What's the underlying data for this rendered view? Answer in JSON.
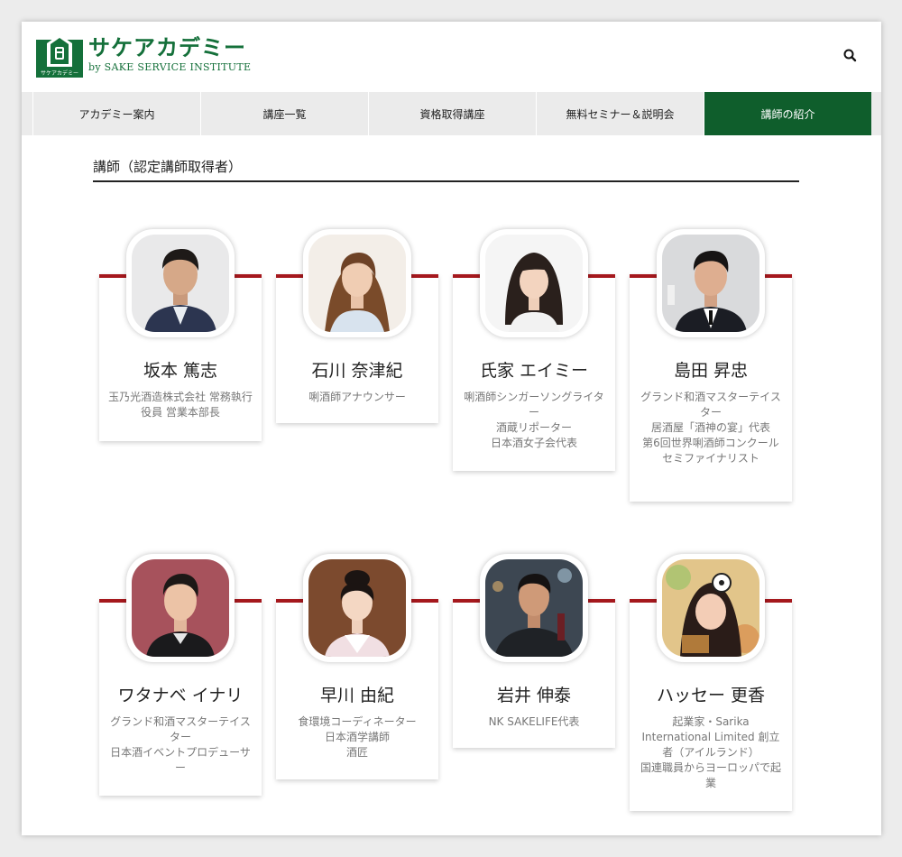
{
  "header": {
    "logo_title": "サケアカデミー",
    "logo_subtitle": "by SAKE SERVICE INSTITUTE",
    "logo_mark_text": "サケアカデミー",
    "brand_color": "#14703a"
  },
  "nav": {
    "items": [
      {
        "label": "アカデミー案内"
      },
      {
        "label": "講座一覧"
      },
      {
        "label": "資格取得講座"
      },
      {
        "label": "無料セミナー＆説明会"
      },
      {
        "label": "講師の紹介"
      }
    ],
    "active_index": 4,
    "active_color": "#0f5e2c"
  },
  "section": {
    "title": "講師（認定講師取得者）"
  },
  "instructors": [
    {
      "name": "坂本 篤志",
      "role": "玉乃光酒造株式会社 常務執行役員 営業本部長"
    },
    {
      "name": "石川 奈津紀",
      "role": "唎酒師アナウンサー"
    },
    {
      "name": "氏家 エイミー",
      "role": "唎酒師シンガーソングライター\n酒蔵リポーター\n日本酒女子会代表"
    },
    {
      "name": "島田 昇忠",
      "role": "グランド和酒マスターテイスター\n居酒屋「酒神の宴」代表\n第6回世界唎酒師コンクール セミファイナリスト"
    },
    {
      "name": "ワタナベ イナリ",
      "role": "グランド和酒マスターテイスター\n日本酒イベントプロデューサー"
    },
    {
      "name": "早川 由紀",
      "role": "食環境コーディネーター\n日本酒学講師\n酒匠"
    },
    {
      "name": "岩井 伸泰",
      "role": "NK SAKELIFE代表"
    },
    {
      "name": "ハッセー 更香",
      "role": "起業家・Sarika International Limited 創立者（アイルランド）\n国連職員からヨーロッパで起業"
    }
  ],
  "accent_color": "#a5181d"
}
